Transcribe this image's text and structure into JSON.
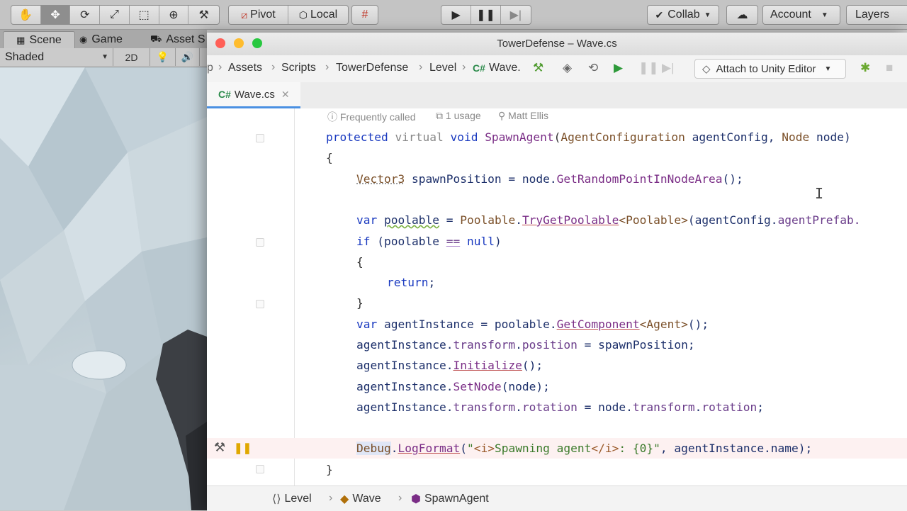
{
  "unity": {
    "toolbar": {
      "tools": [
        "hand-tool",
        "move-tool",
        "rotate-tool",
        "scale-tool",
        "rect-tool",
        "transform-tool",
        "custom-tool"
      ],
      "pivot_label": "Pivot",
      "local_label": "Local",
      "collab_label": "Collab",
      "account_label": "Account",
      "layers_label": "Layers"
    },
    "tabs": {
      "scene": "Scene",
      "game": "Game",
      "asset_store": "Asset S"
    },
    "scene": {
      "shading_mode": "Shaded",
      "mode_2d": "2D"
    }
  },
  "ide": {
    "title": "TowerDefense – Wave.cs",
    "breadcrumbs": [
      "p",
      "Assets",
      "Scripts",
      "TowerDefense",
      "Level",
      "Wave."
    ],
    "breadcrumb_badge": "C#",
    "attach_label": "Attach to Unity Editor",
    "tab": {
      "badge": "C#",
      "label": "Wave.cs"
    },
    "codelens": {
      "frequency": "Frequently called",
      "usages": "1 usage",
      "author": "Matt Ellis"
    },
    "code": {
      "l1": {
        "kw1": "protected",
        "kw2": "virtual",
        "kw3": "void",
        "method": "SpawnAgent",
        "p1": "(",
        "type1": "AgentConfiguration",
        "name1": " agentConfig, ",
        "type2": "Node",
        "name2": " node)"
      },
      "l2": "{",
      "l3": {
        "type": "Vector3",
        "rest": " spawnPosition = node.",
        "method": "GetRandomPointInNodeArea",
        "end": "();"
      },
      "l4": {
        "kw": "var",
        "var": "poolable",
        "eq": " = ",
        "type": "Poolable",
        "dot": ".",
        "method": "TryGetPoolable",
        "gen": "<Poolable>",
        "rest": "(agentConfig.",
        "field": "agentPrefab."
      },
      "l5": {
        "kw": "if",
        "rest1": " (poolable ",
        "op": "==",
        "sp": " ",
        "kw2": "null",
        "rest2": ")"
      },
      "l6": "{",
      "l7": {
        "kw": "return",
        "rest": ";"
      },
      "l8": "}",
      "l9": {
        "kw": "var",
        "rest": " agentInstance = poolable.",
        "method": "GetComponent",
        "gen": "<Agent>",
        "end": "();"
      },
      "l10": {
        "a": "agentInstance.",
        "f1": "transform",
        "b": ".",
        "f2": "position",
        "c": " = spawnPosition;"
      },
      "l11": {
        "a": "agentInstance.",
        "method": "Initialize",
        "c": "();"
      },
      "l12": {
        "a": "agentInstance.",
        "method": "SetNode",
        "c": "(node);"
      },
      "l13": {
        "a": "agentInstance.",
        "f1": "transform",
        "b": ".",
        "f2": "rotation",
        "c": " = node.",
        "f3": "transform",
        "d": ".",
        "f4": "rotation",
        "e": ";"
      },
      "l14": {
        "type": "Debug",
        "dot": ".",
        "method": "LogFormat",
        "p": "(",
        "q1": "\"",
        "t1": "<i>",
        "s1": "Spawning agent",
        "t2": "</i>",
        "s2": ": {0}",
        "q2": "\"",
        "rest": ", agentInstance.name);"
      },
      "l15": "}"
    },
    "status": {
      "ns": "Level",
      "class": "Wave",
      "method": "SpawnAgent"
    }
  }
}
